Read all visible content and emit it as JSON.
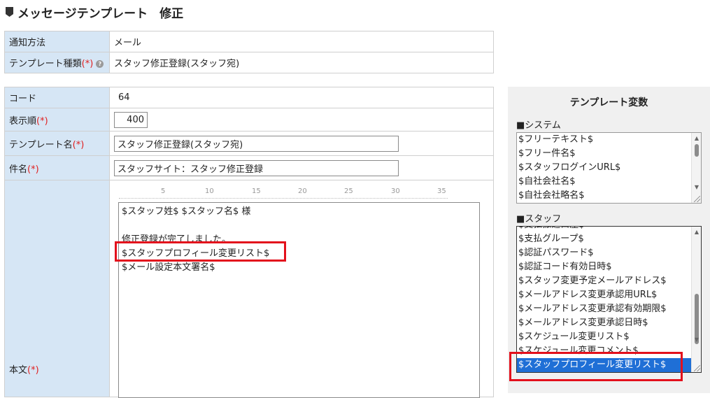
{
  "page": {
    "title": "メッセージテンプレート　修正"
  },
  "form": {
    "notify_method": {
      "label": "通知方法",
      "value": "メール"
    },
    "template_type": {
      "label": "テンプレート種類",
      "required": "(*)",
      "value": "スタッフ修正登録(スタッフ宛)"
    },
    "code": {
      "label": "コード",
      "value": "64"
    },
    "display_order": {
      "label": "表示順",
      "required": "(*)",
      "value": "400"
    },
    "template_name": {
      "label": "テンプレート名",
      "required": "(*)",
      "value": "スタッフ修正登録(スタッフ宛)"
    },
    "subject": {
      "label": "件名",
      "required": "(*)",
      "value": "スタッフサイト：スタッフ修正登録"
    },
    "body": {
      "label": "本文",
      "required": "(*)",
      "ruler": [
        "5",
        "10",
        "15",
        "20",
        "25",
        "30",
        "35"
      ],
      "lines": [
        "$スタッフ姓$ $スタッフ名$ 様",
        "",
        "修正登録が完了しました。",
        "$スタッフプロフィール変更リスト$",
        "$メール設定本文署名$"
      ]
    }
  },
  "variables_panel": {
    "title": "テンプレート変数",
    "system": {
      "label": "■システム",
      "items": [
        "$フリーテキスト$",
        "$フリー件名$",
        "$スタッフログインURL$",
        "$自社会社名$",
        "$自社会社略名$"
      ]
    },
    "staff": {
      "label": "■スタッフ",
      "items": [
        "$支払振込口座$",
        "$支払グループ$",
        "$認証パスワード$",
        "$認証コード有効日時$",
        "$スタッフ変更予定メールアドレス$",
        "$メールアドレス変更承認用URL$",
        "$メールアドレス変更承認有効期限$",
        "$メールアドレス変更承認日時$",
        "$スケジュール変更リスト$",
        "$スケジュール変更コメント$",
        "$スタッフプロフィール変更リスト$"
      ],
      "selected": "$スタッフプロフィール変更リスト$"
    }
  },
  "colors": {
    "label_bg": "#d6e6f5",
    "required": "#e02020",
    "highlight_box": "#e3101c",
    "selected_item": "#1f6fd6",
    "panel_bg": "#f0f0f0"
  }
}
